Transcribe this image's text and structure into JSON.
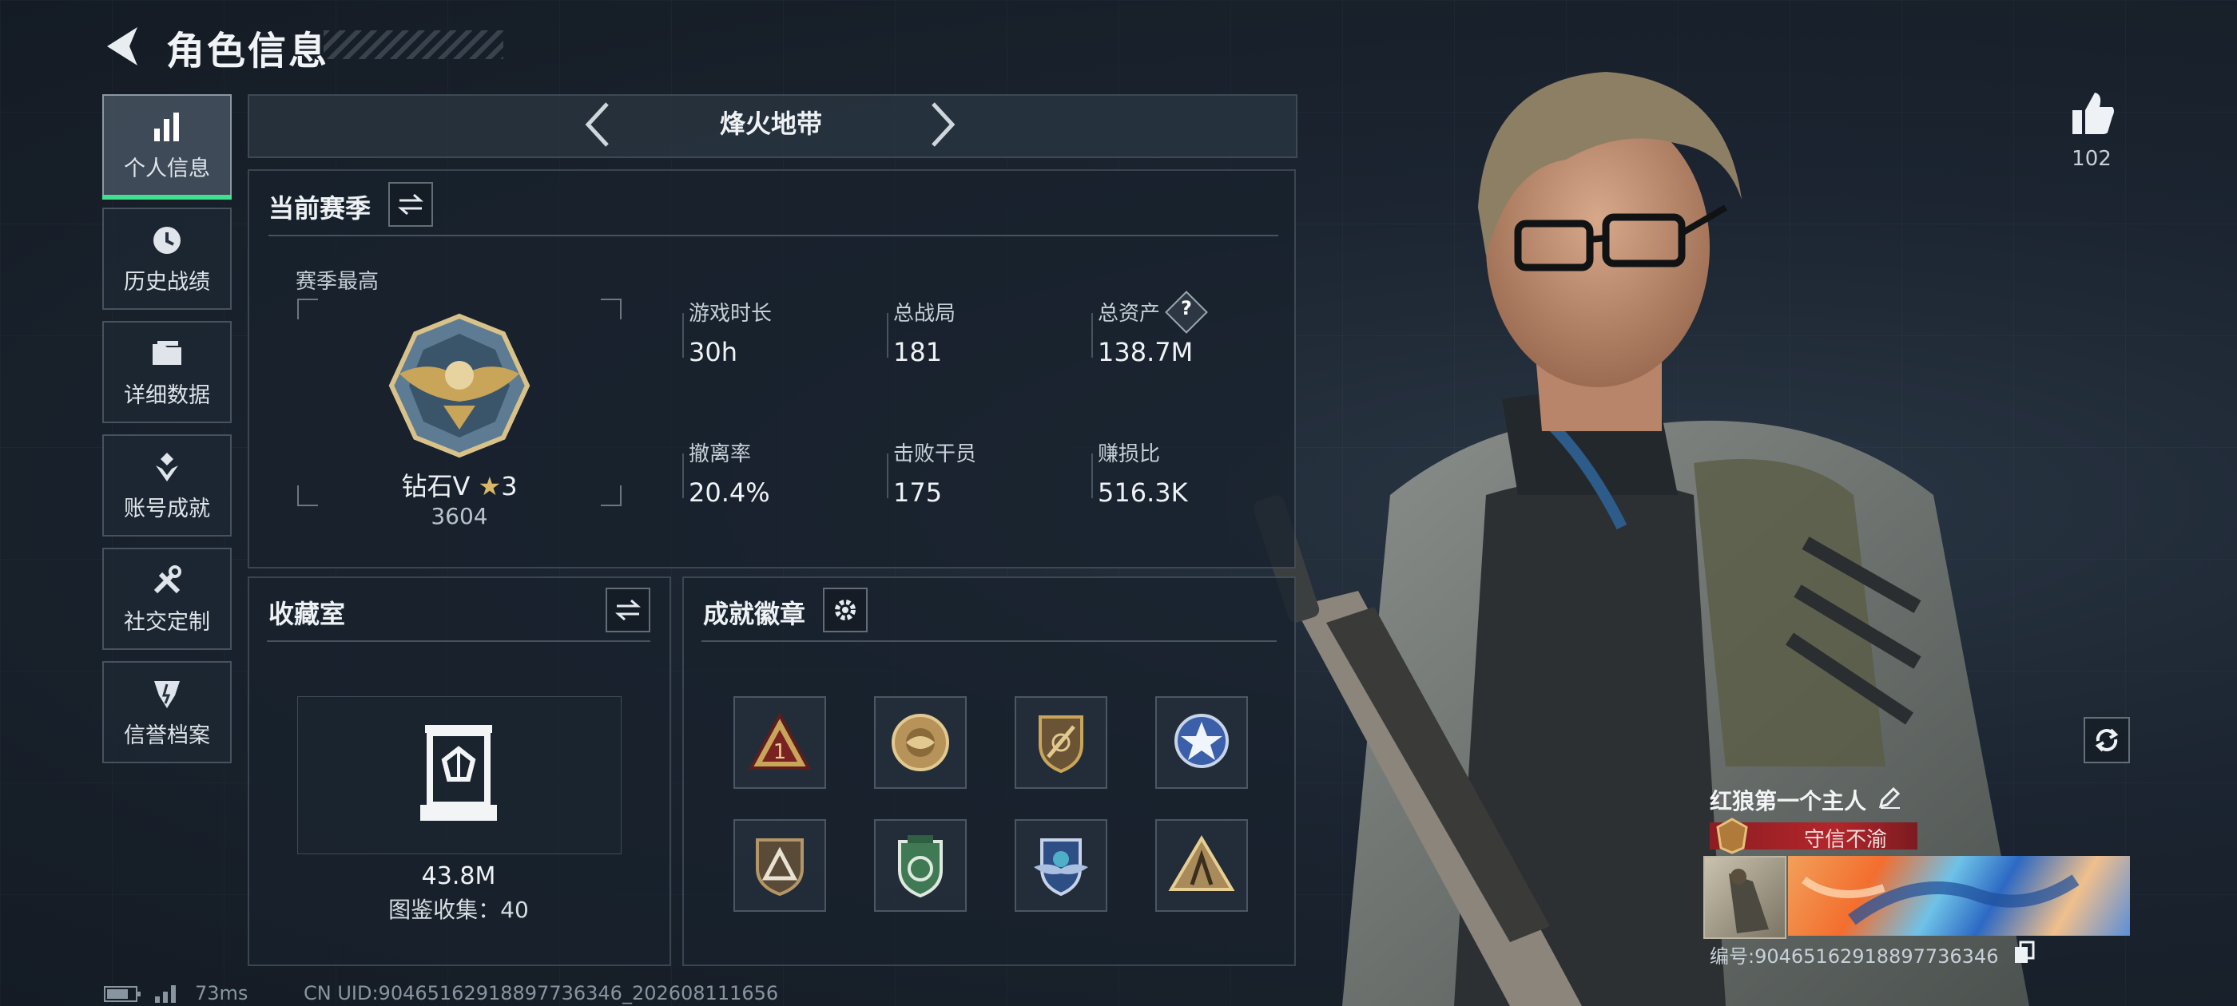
{
  "header": {
    "title": "角色信息"
  },
  "sidebar": {
    "items": [
      {
        "label": "个人信息",
        "icon": "bar-chart-icon",
        "active": true
      },
      {
        "label": "历史战绩",
        "icon": "history-clock-icon"
      },
      {
        "label": "详细数据",
        "icon": "folder-icon"
      },
      {
        "label": "账号成就",
        "icon": "achievement-icon"
      },
      {
        "label": "社交定制",
        "icon": "wrench-tools-icon"
      },
      {
        "label": "信誉档案",
        "icon": "credit-shield-icon"
      }
    ]
  },
  "mode_tab": {
    "title": "烽火地带"
  },
  "season": {
    "title": "当前赛季",
    "best_label": "赛季最高",
    "rank_name": "钻石V",
    "rank_stars": "3",
    "rank_score": "3604",
    "stats": [
      {
        "label": "游戏时长",
        "value": "30h"
      },
      {
        "label": "总战局",
        "value": "181"
      },
      {
        "label": "总资产",
        "value": "138.7M",
        "help": "?"
      },
      {
        "label": "撤离率",
        "value": "20.4%"
      },
      {
        "label": "击败干员",
        "value": "175"
      },
      {
        "label": "赚损比",
        "value": "516.3K"
      }
    ]
  },
  "collection": {
    "title": "收藏室",
    "value": "43.8M",
    "catalog_text": "图鉴收集：40"
  },
  "badges": {
    "title": "成就徽章",
    "items": [
      "rank-1-triangle-badge",
      "gold-round-badge",
      "sword-shield-badge",
      "blue-star-badge",
      "tri-shield-badge",
      "green-shield-badge",
      "blue-wings-badge",
      "gold-triangle-badge"
    ]
  },
  "likes": {
    "count": "102"
  },
  "player": {
    "name": "红狼第一个主人",
    "motto": "守信不渝",
    "id_text": "编号:904651629188977363​46"
  },
  "status_bar": {
    "ping": "73ms",
    "uid_text": "CN UID:904651629188977363​46_202608111656"
  },
  "colors": {
    "accent_green": "#3fe08e",
    "motto_red": "#b3262b",
    "panel_bg": "#18212c"
  }
}
